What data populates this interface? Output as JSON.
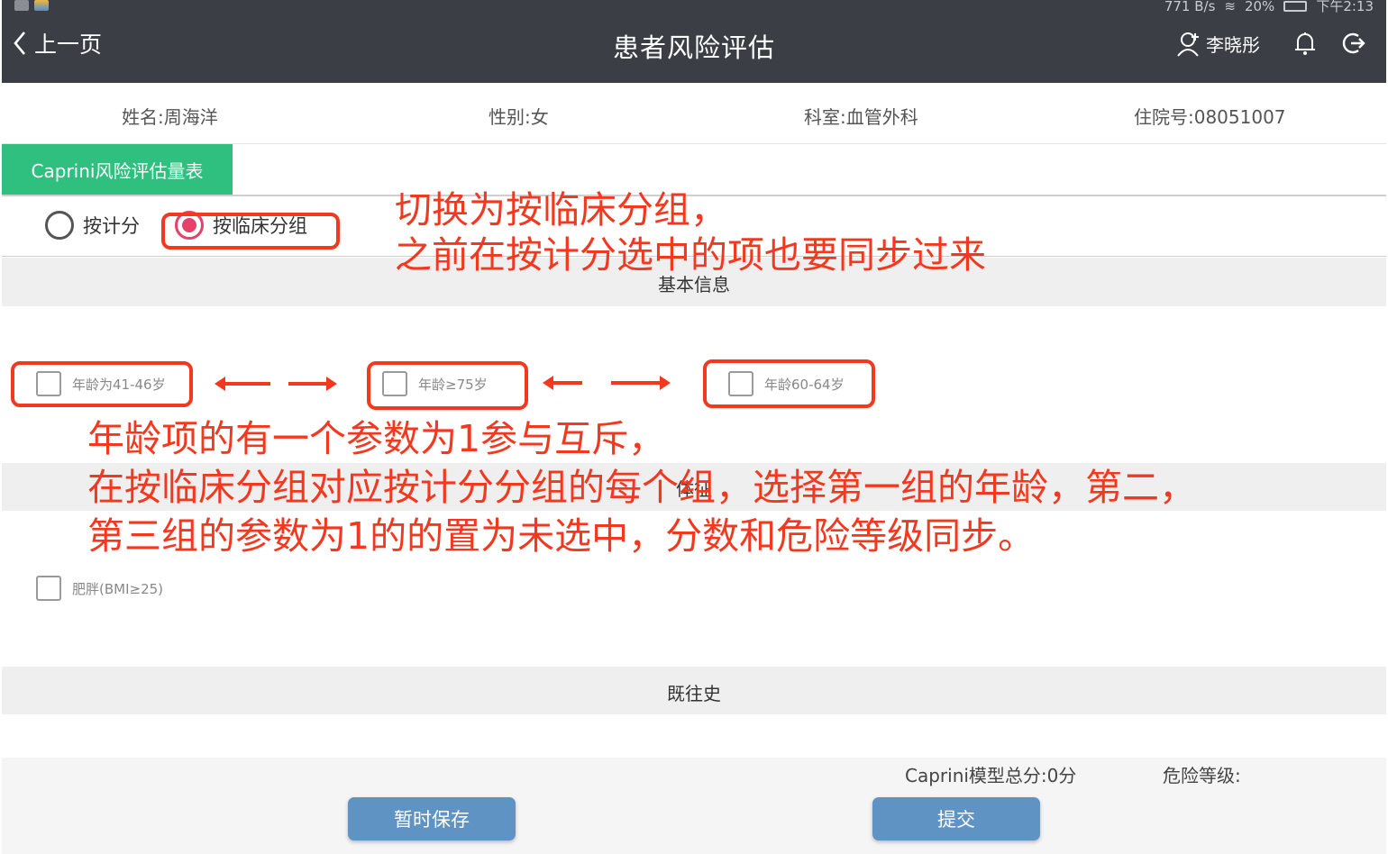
{
  "status_bar": {
    "left_icons": [
      "gallery-icon",
      "app-icon"
    ],
    "net_speed": "771 B/s",
    "battery_pct": "20%",
    "time": "下午2:13"
  },
  "header": {
    "back_label": "上一页",
    "title": "患者风险评估",
    "user_name": "李晓彤"
  },
  "patient": {
    "name": "姓名:周海洋",
    "gender": "性别:女",
    "department": "科室:血管外科",
    "admission_no": "住院号:08051007"
  },
  "tab": {
    "label": "Caprini风险评估量表"
  },
  "mode": {
    "option_score": "按计分",
    "option_clinical": "按临床分组",
    "selected": "option_clinical"
  },
  "sections": {
    "basic_info": "基本信息",
    "physical_signs": "体征",
    "history": "既往史"
  },
  "age_options": [
    {
      "label": "年龄为41-46岁",
      "checked": false
    },
    {
      "label": "年龄≥75岁",
      "checked": false
    },
    {
      "label": "年龄60-64岁",
      "checked": false
    }
  ],
  "sign_options": [
    {
      "label": "肥胖(BMI≥25)",
      "checked": false
    }
  ],
  "footer": {
    "total_score": "Caprini模型总分:0分",
    "risk_level": "危险等级:",
    "save_label": "暂时保存",
    "submit_label": "提交"
  },
  "annotations": {
    "note1_line1": "切换为按临床分组，",
    "note1_line2": "之前在按计分选中的项也要同步过来",
    "note2_line1": "年龄项的有一个参数为1参与互斥，",
    "note2_line2": "在按临床分组对应按计分分组的每个组，选择第一组的年龄，第二，",
    "note2_line3": "第三组的参数为1的的置为未选中，分数和危险等级同步。"
  },
  "colors": {
    "header_bg": "#3b3e45",
    "tab_green": "#2fbf7f",
    "radio_accent": "#e8406a",
    "annotation_red": "#f2391f",
    "button_blue": "#5f93c4"
  }
}
